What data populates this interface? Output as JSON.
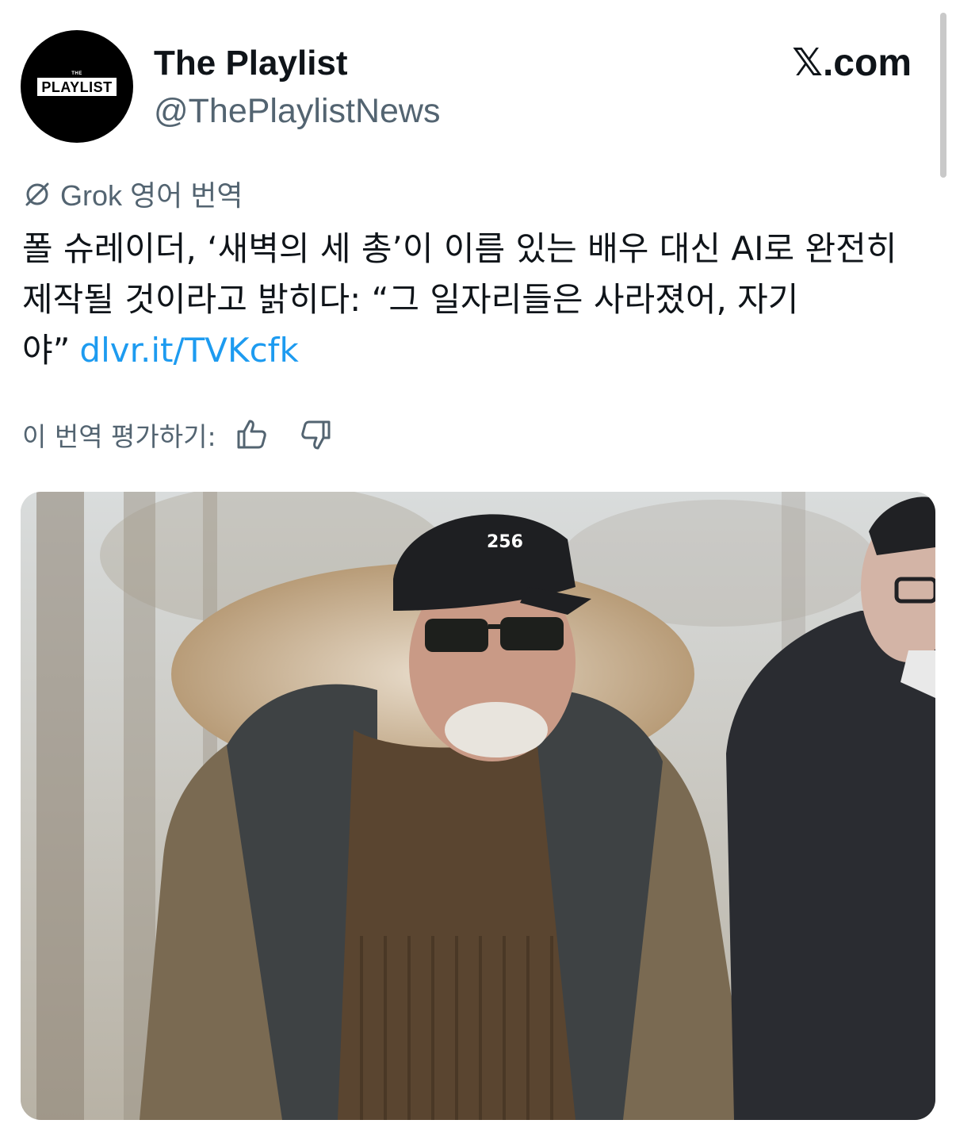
{
  "account": {
    "avatar_text": "PLAYLIST",
    "avatar_small_text": "THE",
    "display_name": "The Playlist",
    "handle": "@ThePlaylistNews"
  },
  "site": {
    "brand": "𝕏.com"
  },
  "translation": {
    "label": "Grok 영어 번역",
    "rate_label": "이 번역 평가하기:"
  },
  "post": {
    "text": "폴 슈레이더, ‘새벽의 세 총’이 이름 있는 배우 대신 AI로 완전히 제작될 것이라고 밝히다: “그 일자리들은 사라졌어, 자기야”",
    "link_text": "dlvr.it/TVKcfk"
  },
  "media": {
    "cap_text": "256"
  },
  "colors": {
    "text_primary": "#0f1419",
    "text_secondary": "#536471",
    "link": "#1d9bf0"
  },
  "icons": {
    "grok": "grok-icon",
    "thumbs_up": "thumbs-up-icon",
    "thumbs_down": "thumbs-down-icon"
  }
}
